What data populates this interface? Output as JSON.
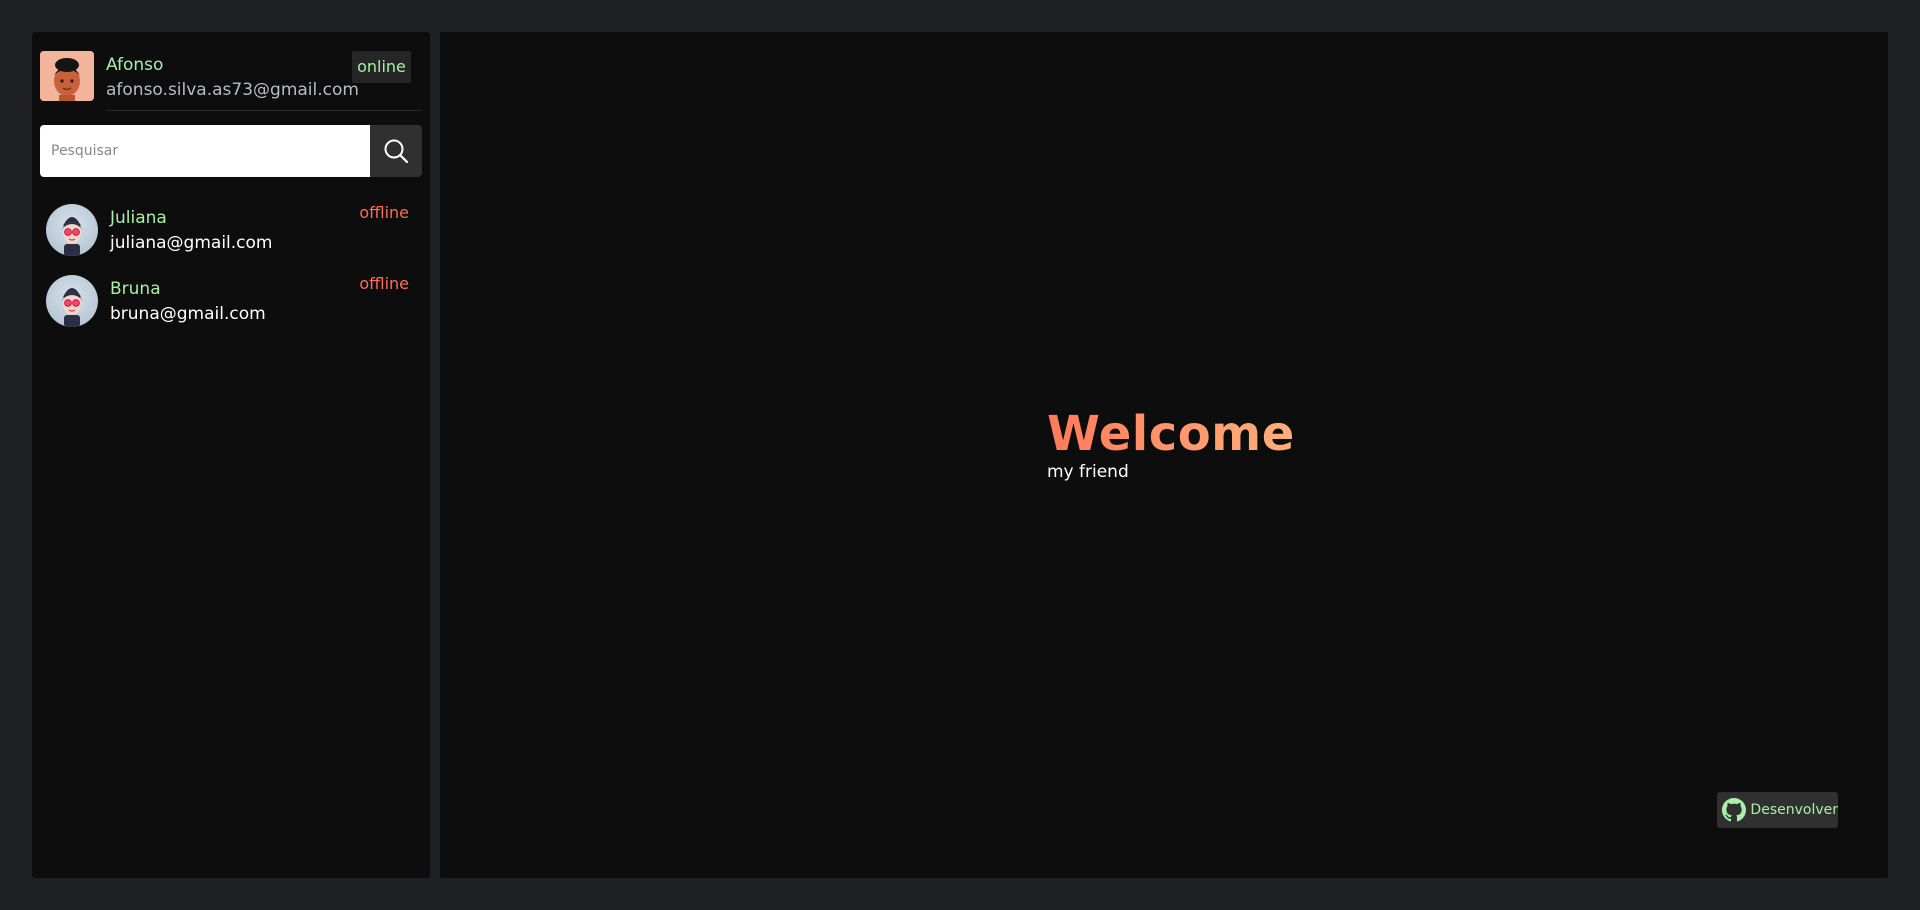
{
  "profile": {
    "name": "Afonso",
    "email": "afonso.silva.as73@gmail.com",
    "status": "online",
    "avatar_icon": "user-avatar-icon"
  },
  "search": {
    "placeholder": "Pesquisar",
    "value": "",
    "icon": "search-icon"
  },
  "contacts": [
    {
      "name": "Juliana",
      "email": "juliana@gmail.com",
      "status": "offline"
    },
    {
      "name": "Bruna",
      "email": "bruna@gmail.com",
      "status": "offline"
    }
  ],
  "main": {
    "welcome_title": "Welcome",
    "welcome_subtitle": "my friend"
  },
  "footer": {
    "github_label": "Desenvolver",
    "github_icon": "github-icon"
  },
  "colors": {
    "background": "#1f2024",
    "panel": "#0d0d0d",
    "online": "#a8f0a8",
    "offline": "#ff6b57",
    "accent": "#ff7a5a"
  }
}
